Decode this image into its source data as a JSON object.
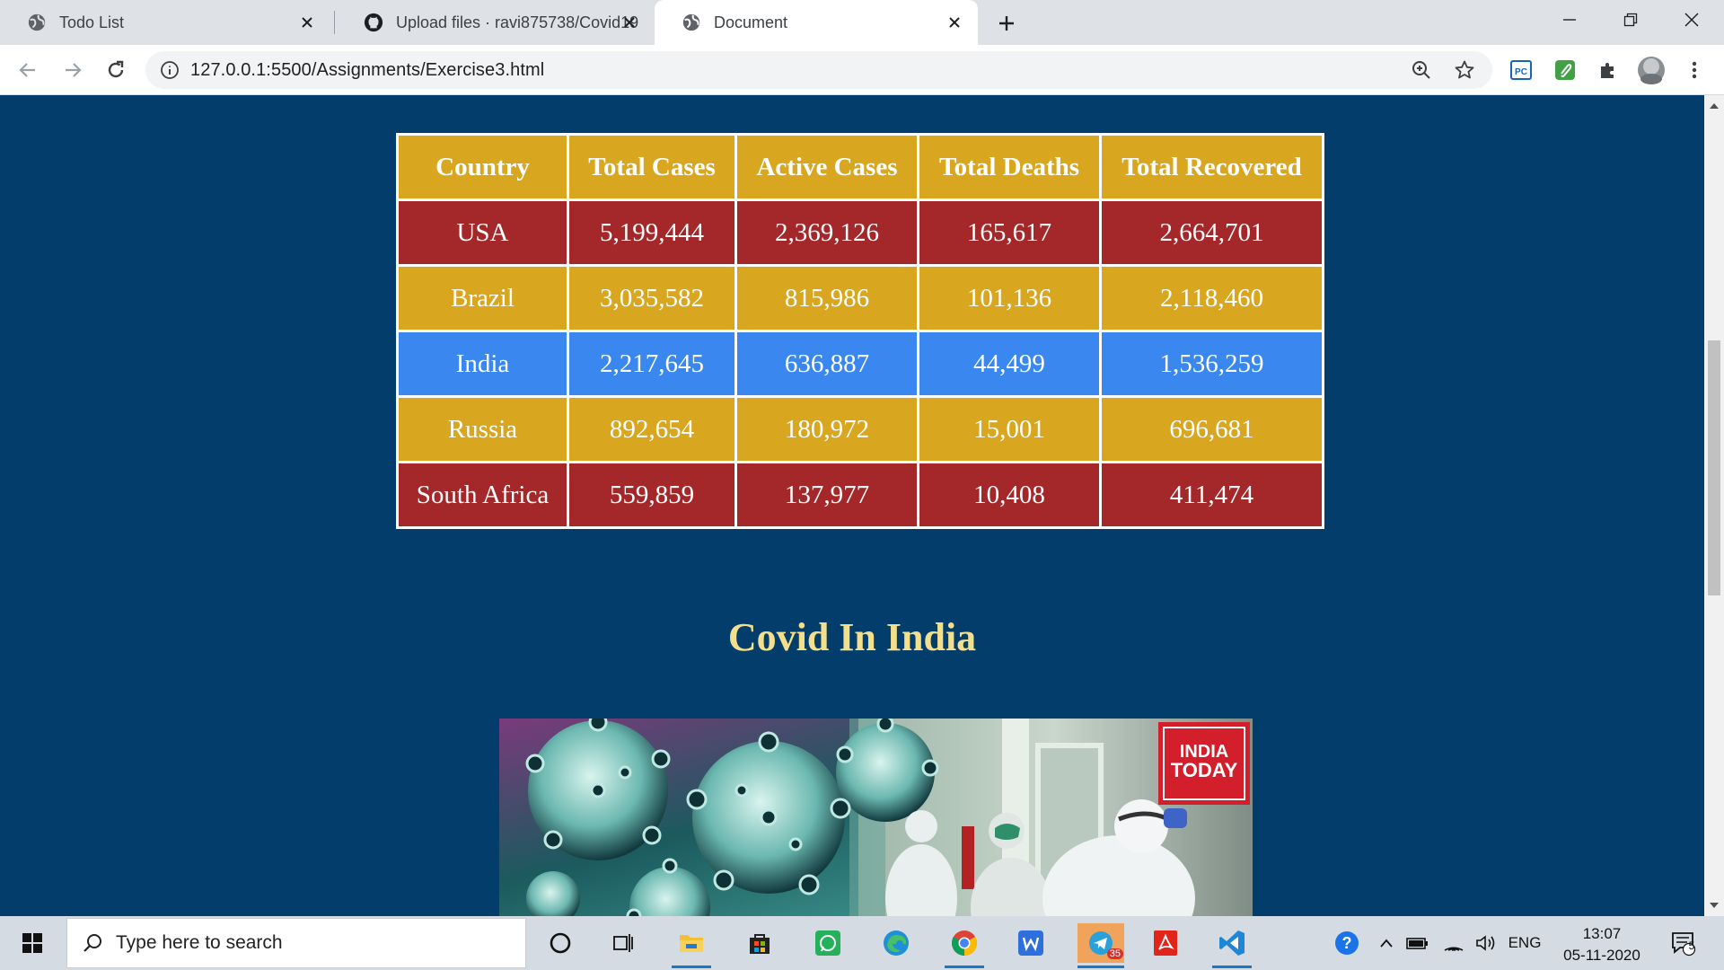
{
  "tabs": [
    {
      "title": "Todo List",
      "favicon": "globe-icon",
      "active": false
    },
    {
      "title": "Upload files · ravi875738/Covid19",
      "favicon": "github-icon",
      "active": false
    },
    {
      "title": "Document",
      "favicon": "globe-icon",
      "active": true
    }
  ],
  "toolbar": {
    "url": "127.0.0.1:5500/Assignments/Exercise3.html"
  },
  "table": {
    "headers": [
      "Country",
      "Total Cases",
      "Active Cases",
      "Total Deaths",
      "Total Recovered"
    ],
    "rows": [
      [
        "USA",
        "5,199,444",
        "2,369,126",
        "165,617",
        "2,664,701"
      ],
      [
        "Brazil",
        "3,035,582",
        "815,986",
        "101,136",
        "2,118,460"
      ],
      [
        "India",
        "2,217,645",
        "636,887",
        "44,499",
        "1,536,259"
      ],
      [
        "Russia",
        "892,654",
        "180,972",
        "15,001",
        "696,681"
      ],
      [
        "South Africa",
        "559,859",
        "137,977",
        "10,408",
        "411,474"
      ]
    ],
    "colors": {
      "header": "#d9a620",
      "red": "#a4282a",
      "gold": "#d9a620",
      "blue": "#3a87ef"
    }
  },
  "page": {
    "heading": "Covid In India",
    "background": "#023d6b",
    "image_badge": {
      "line1": "INDIA",
      "line2": "TODAY"
    }
  },
  "taskbar": {
    "search_placeholder": "Type here to search",
    "telegram_badge": "35",
    "language": "ENG",
    "time": "13:07",
    "date": "05-11-2020",
    "notification_count": "5"
  }
}
